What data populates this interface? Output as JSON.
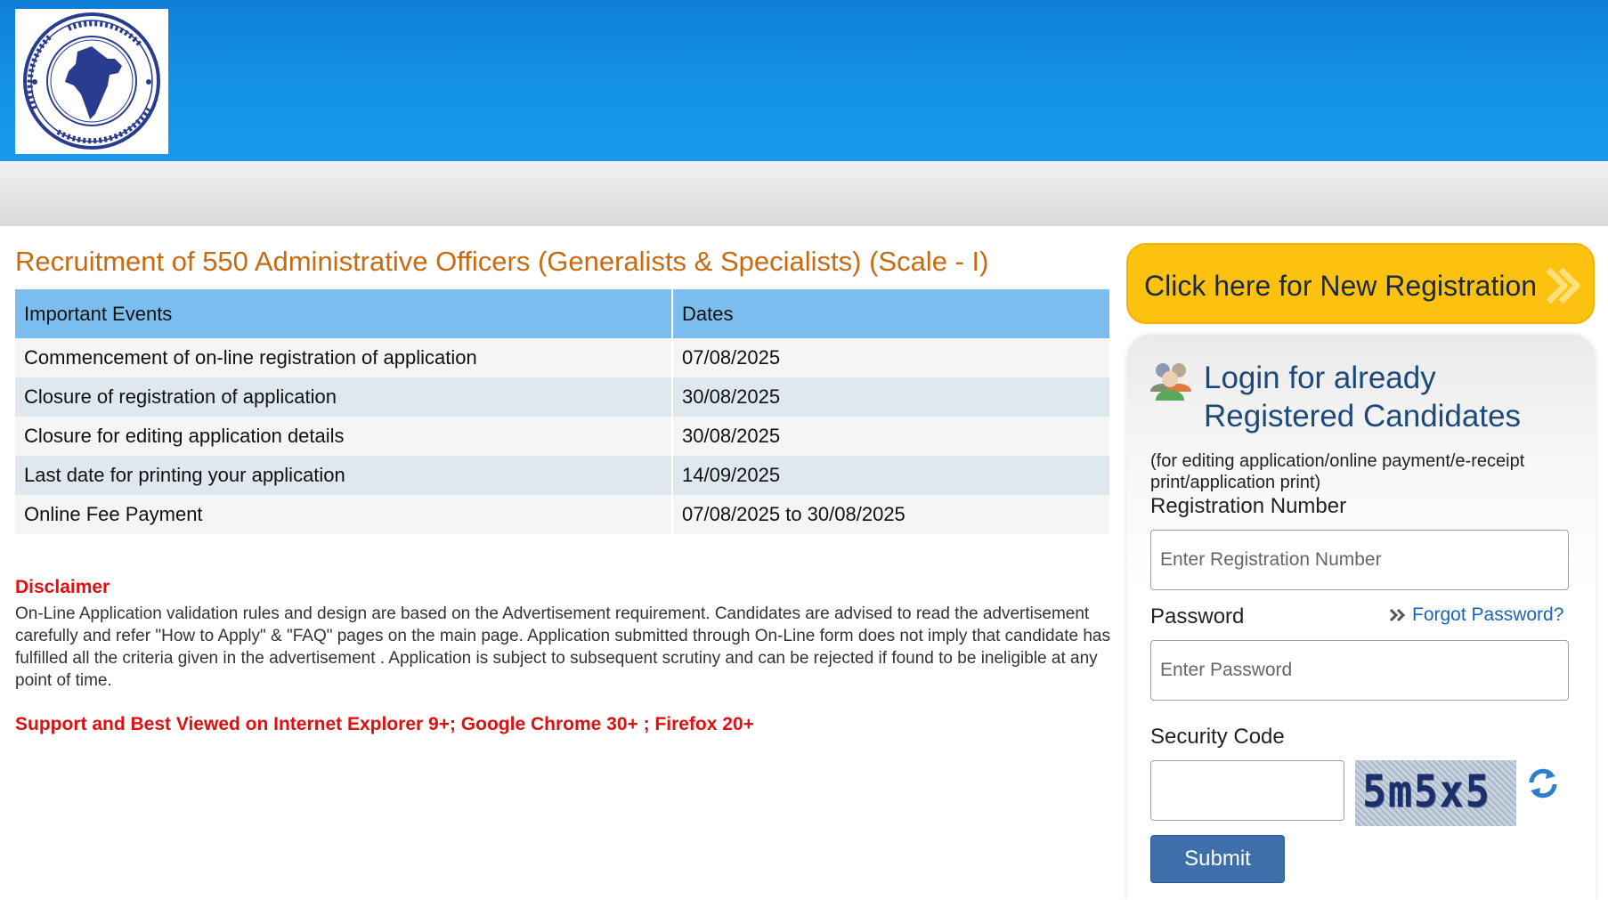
{
  "header": {
    "logo_text": "THE NEW INDIA ASSURANCE CO. LTD."
  },
  "main": {
    "title": "Recruitment of 550 Administrative Officers (Generalists & Specialists) (Scale - I)",
    "table": {
      "headers": [
        "Important Events",
        "Dates"
      ],
      "rows": [
        {
          "event": "Commencement of on-line registration of application",
          "date": "07/08/2025"
        },
        {
          "event": "Closure of registration of application",
          "date": "30/08/2025"
        },
        {
          "event": "Closure for editing application details",
          "date": "30/08/2025"
        },
        {
          "event": "Last date for printing your application",
          "date": "14/09/2025"
        },
        {
          "event": "Online Fee Payment",
          "date": "07/08/2025 to 30/08/2025"
        }
      ]
    },
    "disclaimer": {
      "heading": "Disclaimer",
      "body": "On-Line Application validation rules and design are based on the Advertisement requirement. Candidates are advised to read the advertisement carefully and refer \"How to Apply\" & \"FAQ\" pages on the main page. Application submitted through On-Line form does not imply that candidate has fulfilled all the criteria given in the advertisement . Application is subject to subsequent scrutiny and can be rejected if found to be ineligible at any point of time."
    },
    "support_note": "Support and Best Viewed on Internet Explorer 9+; Google Chrome 30+ ; Firefox 20+"
  },
  "sidebar": {
    "new_registration_label": "Click here for New Registration",
    "login": {
      "title": "Login for already Registered Candidates",
      "note": "(for editing application/online payment/e-receipt print/application print)",
      "registration_label": "Registration Number",
      "registration_placeholder": "Enter Registration Number",
      "registration_value": "",
      "password_label": "Password",
      "password_placeholder": "Enter Password",
      "password_value": "",
      "forgot_label": "Forgot Password?",
      "security_label": "Security Code",
      "security_value": "",
      "captcha_text": "5m5x5",
      "submit_label": "Submit"
    }
  },
  "colors": {
    "header_blue": "#1492e8",
    "title_orange": "#c86a12",
    "table_header": "#7bbdef",
    "alert_red": "#e01010",
    "registration_button": "#fdc10f",
    "submit_button": "#3f6fab",
    "login_title": "#1b4a7a"
  },
  "icons": [
    "india-map-logo-icon",
    "double-chevron-right-icon",
    "users-icon",
    "refresh-icon"
  ]
}
